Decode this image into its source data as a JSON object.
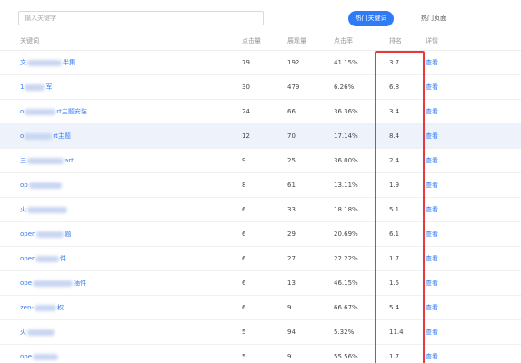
{
  "search": {
    "placeholder": "输入关键字",
    "value": ""
  },
  "tabs": {
    "active": "热门关键词",
    "inactive": "热门页面"
  },
  "columns": {
    "keyword": "关键词",
    "clicks": "点击量",
    "views": "展现量",
    "ctr": "点击率",
    "rank": "排名",
    "detail": "详情"
  },
  "rows": [
    {
      "kw_pre": "文",
      "kw_post": "半集",
      "clicks": "79",
      "views": "192",
      "ctr": "41.15%",
      "rank": "3.7",
      "detail": "查看"
    },
    {
      "kw_pre": "1",
      "kw_post": "军",
      "clicks": "30",
      "views": "479",
      "ctr": "6.26%",
      "rank": "6.8",
      "detail": "查看"
    },
    {
      "kw_pre": "o",
      "kw_post": "rt主题安装",
      "clicks": "24",
      "views": "66",
      "ctr": "36.36%",
      "rank": "3.4",
      "detail": "查看"
    },
    {
      "kw_pre": "o",
      "kw_post": "rt主题",
      "clicks": "12",
      "views": "70",
      "ctr": "17.14%",
      "rank": "8.4",
      "detail": "查看"
    },
    {
      "kw_pre": "三",
      "kw_post": "art",
      "clicks": "9",
      "views": "25",
      "ctr": "36.00%",
      "rank": "2.4",
      "detail": "查看"
    },
    {
      "kw_pre": "op",
      "kw_post": "",
      "clicks": "8",
      "views": "61",
      "ctr": "13.11%",
      "rank": "1.9",
      "detail": "查看"
    },
    {
      "kw_pre": "火",
      "kw_post": "",
      "clicks": "6",
      "views": "33",
      "ctr": "18.18%",
      "rank": "5.1",
      "detail": "查看"
    },
    {
      "kw_pre": "open",
      "kw_post": "题",
      "clicks": "6",
      "views": "29",
      "ctr": "20.69%",
      "rank": "6.1",
      "detail": "查看"
    },
    {
      "kw_pre": "oper",
      "kw_post": "件",
      "clicks": "6",
      "views": "27",
      "ctr": "22.22%",
      "rank": "1.7",
      "detail": "查看"
    },
    {
      "kw_pre": "ope",
      "kw_post": "插件",
      "clicks": "6",
      "views": "13",
      "ctr": "46.15%",
      "rank": "1.5",
      "detail": "查看"
    },
    {
      "kw_pre": "zen-",
      "kw_post": "权",
      "clicks": "6",
      "views": "9",
      "ctr": "66.67%",
      "rank": "5.4",
      "detail": "查看"
    },
    {
      "kw_pre": "火",
      "kw_post": "",
      "clicks": "5",
      "views": "94",
      "ctr": "5.32%",
      "rank": "11.4",
      "detail": "查看"
    },
    {
      "kw_pre": "ope",
      "kw_post": "",
      "clicks": "5",
      "views": "9",
      "ctr": "55.56%",
      "rank": "1.7",
      "detail": "查看"
    }
  ],
  "colors": {
    "accent": "#2f7bf5",
    "highlight_row": "#eef3fb",
    "outline": "#e8383d"
  },
  "highlighted_row": 3
}
